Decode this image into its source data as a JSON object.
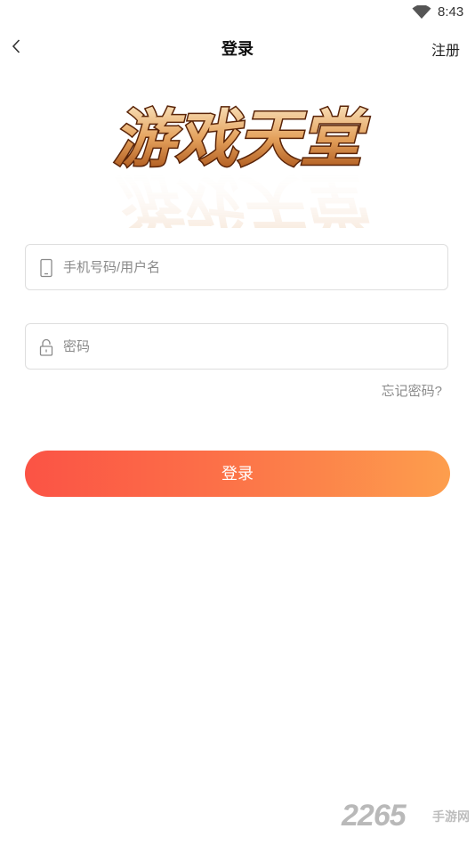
{
  "status_bar": {
    "time": "8:43",
    "wifi_icon": "wifi-icon"
  },
  "header": {
    "back_icon": "chevron-left-icon",
    "title": "登录",
    "register_label": "注册"
  },
  "logo": {
    "text": "游戏天堂",
    "colors": {
      "fill_top": "#f6d6a6",
      "fill_bottom": "#b65d1c",
      "stroke": "#5a2408"
    }
  },
  "form": {
    "phone": {
      "placeholder": "手机号码/用户名",
      "value": "",
      "icon": "phone-icon"
    },
    "password": {
      "placeholder": "密码",
      "value": "",
      "icon": "lock-icon"
    },
    "forgot_label": "忘记密码?",
    "login_label": "登录"
  },
  "colors": {
    "button_start": "#fb5345",
    "button_end": "#fd9e4d",
    "border": "#dedede",
    "hint_text": "#8c8c8c"
  },
  "watermark": {
    "number": "2265",
    "suffix": "手游网"
  }
}
